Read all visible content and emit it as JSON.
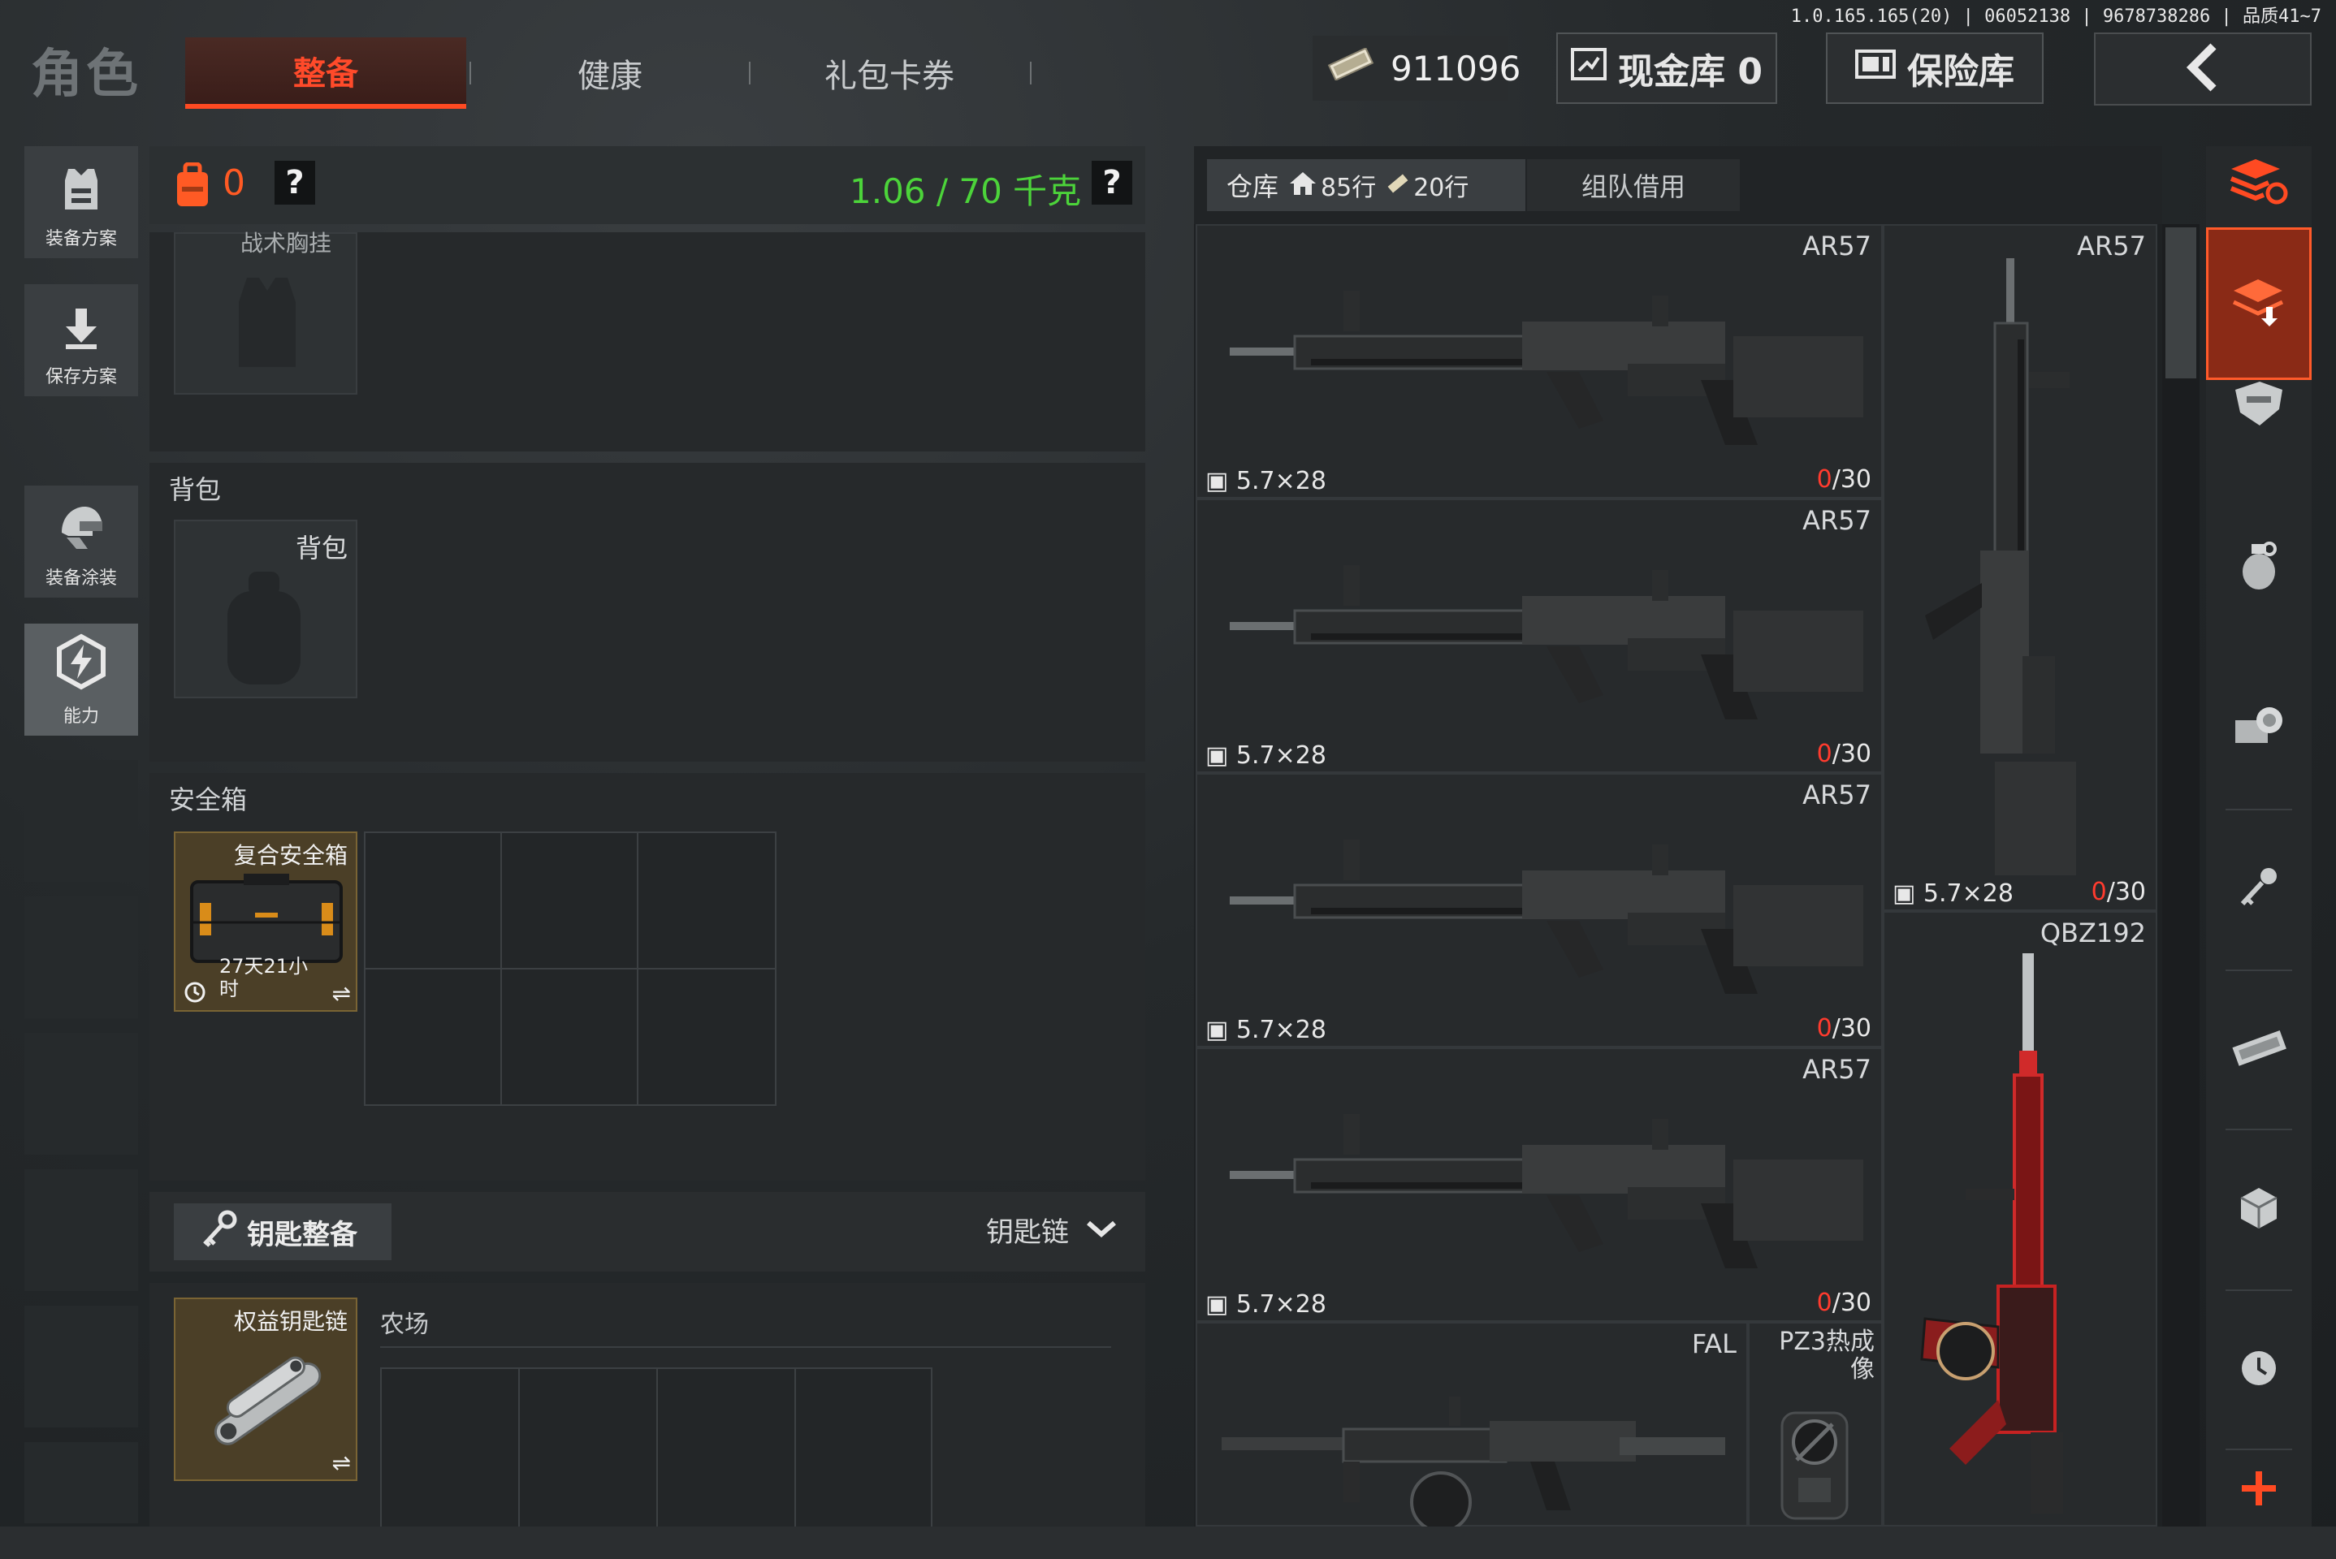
{
  "version_text": "1.0.165.165(20) | 06052138 | 9678738286 | 品质41~7",
  "header": {
    "title": "角色",
    "tabs": [
      {
        "label": "整备",
        "active": true
      },
      {
        "label": "健康",
        "active": false
      },
      {
        "label": "礼包卡券",
        "active": false
      }
    ],
    "money": "911096",
    "cash_vault_label": "现金库 0",
    "safe_vault_label": "保险库"
  },
  "sidebar": {
    "items": [
      {
        "label": "装备方案",
        "icon": "vest-icon"
      },
      {
        "label": "保存方案",
        "icon": "download-icon"
      },
      {
        "label": "装备涂装",
        "icon": "helmet-icon"
      },
      {
        "label": "能力",
        "icon": "bolt-hexagon-icon"
      }
    ]
  },
  "loadout": {
    "backpack_count": "0",
    "help": "?",
    "weight": "1.06 / 70 千克",
    "tactical_rig_label": "战术胸挂",
    "backpack_section": "背包",
    "backpack_slot_label": "背包",
    "safebox_section": "安全箱",
    "safebox_item": "复合安全箱",
    "safebox_time": "27天21小时",
    "key_section_label": "钥匙整备",
    "keychain_dropdown": "钥匙链",
    "keychain_item": "权益钥匙链",
    "keychain_map": "农场"
  },
  "warehouse": {
    "tab_label": "仓库",
    "rows_home": "85行",
    "rows_extra": "20行",
    "team_borrow": "组队借用",
    "items": [
      {
        "name": "AR57",
        "ammo": "5.7×28",
        "count_loaded": "0",
        "count_max": "/30"
      },
      {
        "name": "AR57",
        "ammo": "5.7×28",
        "count_loaded": "0",
        "count_max": "/30"
      },
      {
        "name": "AR57",
        "ammo": "5.7×28",
        "count_loaded": "0",
        "count_max": "/30"
      },
      {
        "name": "AR57",
        "ammo": "5.7×28",
        "count_loaded": "0",
        "count_max": "/30"
      },
      {
        "name": "AR57",
        "ammo": "5.7×28",
        "count_loaded": "0",
        "count_max": "/30"
      },
      {
        "name": "QBZ192",
        "ammo": "",
        "count_loaded": "",
        "count_max": ""
      },
      {
        "name": "FAL",
        "ammo": "",
        "count_loaded": "",
        "count_max": ""
      },
      {
        "name": "PZ3热成像",
        "ammo": "",
        "count_loaded": "",
        "count_max": ""
      }
    ]
  },
  "right_bar_icons": [
    "stack-refresh-icon",
    "stack-download-icon",
    "armor-icon",
    "grenade-icon",
    "coins-icon",
    "key-icon",
    "cash-icon",
    "box-icon",
    "clock-icon",
    "plus-icon"
  ],
  "colors": {
    "accent": "#ff4a22",
    "weight_green": "#4cd43a",
    "danger_red": "#ff3b2e"
  }
}
